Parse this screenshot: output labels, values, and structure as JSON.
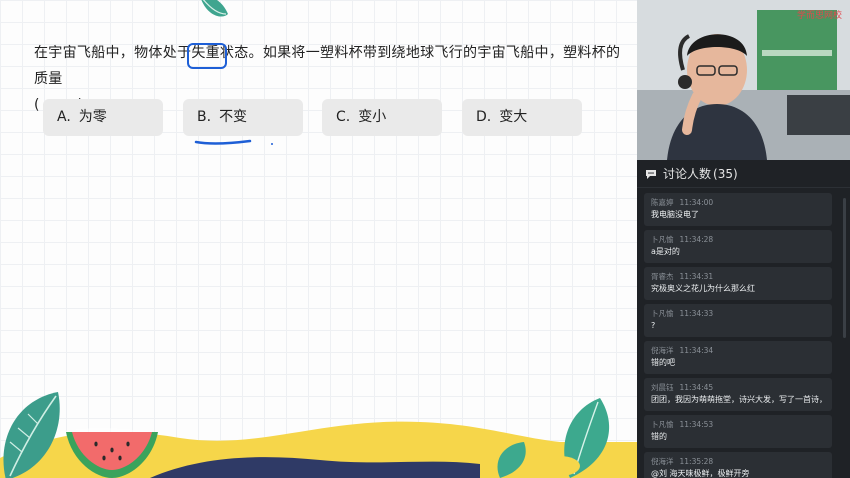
{
  "question": {
    "text_before": "在宇宙飞船中，物体处于",
    "highlight": "失重状",
    "text_after": "态。如果将一塑料杯带到绕地球飞行的宇宙飞船中，塑料杯的质量",
    "blank": "(        )"
  },
  "options": [
    {
      "letter": "A.",
      "text": "为零"
    },
    {
      "letter": "B.",
      "text": "不变"
    },
    {
      "letter": "C.",
      "text": "变小"
    },
    {
      "letter": "D.",
      "text": "变大"
    }
  ],
  "video": {
    "watermark": "学而思网校"
  },
  "chat": {
    "title": "讨论人数",
    "count": "(35)",
    "messages": [
      {
        "user": "陈嘉婷",
        "time": "11:34:00",
        "text": "我电脑没电了"
      },
      {
        "user": "卜凡愉",
        "time": "11:34:28",
        "text": "a是对的"
      },
      {
        "user": "胥睿杰",
        "time": "11:34:31",
        "text": "究极奥义之花儿为什么那么红"
      },
      {
        "user": "卜凡愉",
        "time": "11:34:33",
        "text": "?"
      },
      {
        "user": "倪海洋",
        "time": "11:34:34",
        "text": "错的吧"
      },
      {
        "user": "刘晨钰",
        "time": "11:34:45",
        "text": "团团，我因为萌萌拖堂，诗兴大发，写了一首诗，请您鉴赏"
      },
      {
        "user": "卜凡愉",
        "time": "11:34:53",
        "text": "错的"
      },
      {
        "user": "倪海洋",
        "time": "11:35:28",
        "text": "@刘 海天味极鲜，极鲜开旁"
      }
    ]
  },
  "colors": {
    "ink_blue": "#1e5fd6",
    "watermark_red": "#e2484d",
    "chat_bg": "#1f2226"
  }
}
